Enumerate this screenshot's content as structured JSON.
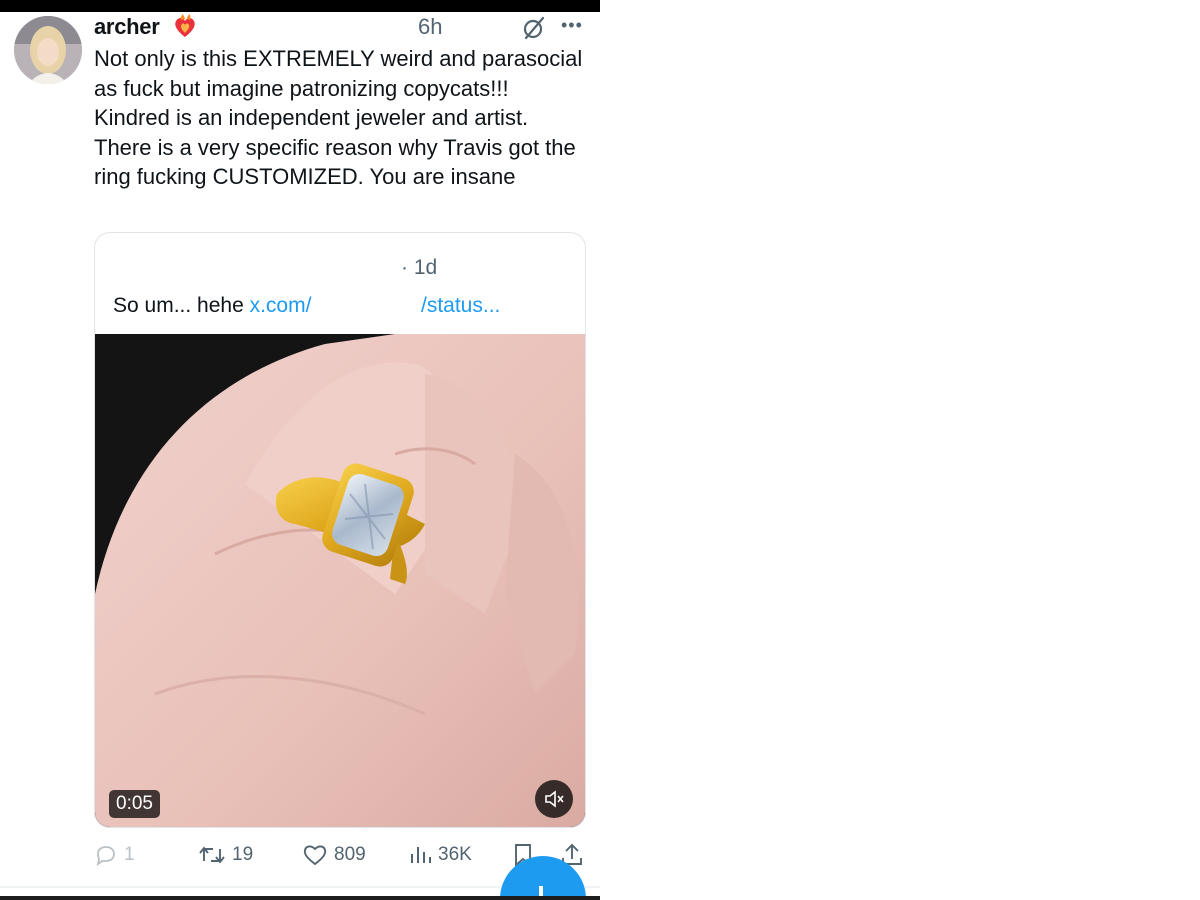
{
  "post": {
    "author": "archer",
    "time_ago": "6h",
    "text": "Not only is this EXTREMELY weird and parasocial as fuck but imagine patronizing copycats!!! Kindred is an independent jeweler and artist. There is a very specific reason why Travis got the ring fucking CUSTOMIZED. You are insane"
  },
  "quoted_post": {
    "time_ago": "· 1d",
    "text": "So um... hehe ",
    "link_part1": "x.com/",
    "link_part2": "/status...",
    "video_duration": "0:05"
  },
  "actions": {
    "replies": "1",
    "retweets": "19",
    "likes": "809",
    "views": "36K"
  },
  "icons": {
    "author_badge": "heart-on-fire-icon",
    "grok": "grok-icon",
    "more": "more-icon",
    "reply": "reply-icon",
    "retweet": "retweet-icon",
    "like": "heart-icon",
    "views": "views-icon",
    "bookmark": "bookmark-icon",
    "share": "share-icon",
    "mute": "mute-icon",
    "compose": "plus-icon"
  },
  "colors": {
    "link": "#1d9bf0",
    "secondary_text": "#536471",
    "fab": "#1d9bf0"
  }
}
